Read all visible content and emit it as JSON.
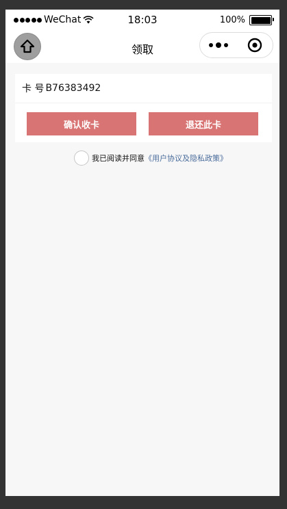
{
  "status_bar": {
    "carrier": "WeChat",
    "time": "18:03",
    "battery": "100%"
  },
  "nav": {
    "title": "领取",
    "home_icon": "home-icon",
    "more_icon": "more-dots-icon",
    "close_icon": "close-target-icon"
  },
  "card": {
    "label": "卡 号",
    "number": "B76383492"
  },
  "buttons": {
    "confirm": "确认收卡",
    "return": "退还此卡"
  },
  "agreement": {
    "text": "我已阅读并同意",
    "link": "《用户协议及隐私政策》"
  },
  "colors": {
    "button_bg": "#d97474",
    "link": "#4a6c9b",
    "page_bg": "#f7f7f7",
    "frame": "#333333"
  }
}
